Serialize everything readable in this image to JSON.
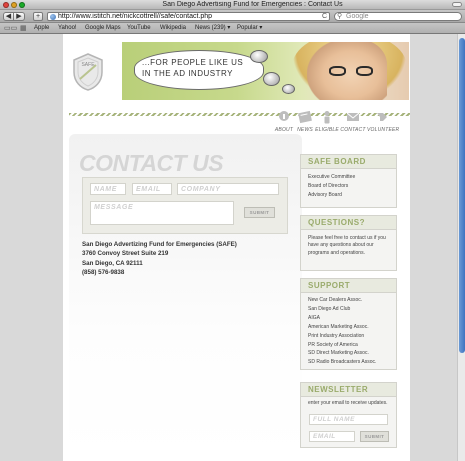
{
  "window": {
    "title": "San Diego Advertising Fund for Emergencies : Contact Us"
  },
  "toolbar": {
    "back": "◀",
    "forward": "▶",
    "add": "+",
    "url": "http://www.istitch.net/nickcottrell//safe/contact.php",
    "reload": "C",
    "search_placeholder": "Google"
  },
  "bookmarks": {
    "items": [
      "Apple",
      "Yahoo!",
      "Google Maps",
      "YouTube",
      "Wikipedia",
      "News (239) ▾",
      "Popular ▾"
    ]
  },
  "banner": {
    "line1": "...FOR PEOPLE LIKE US",
    "line2": "IN THE AD INDUSTRY"
  },
  "logo": {
    "text": "SAFE"
  },
  "top_nav": [
    "ABOUT",
    "NEWS",
    "ELIGIBLE",
    "CONTACT",
    "VOLUNTEER"
  ],
  "contact": {
    "title": "CONTACT US",
    "name_placeholder": "NAME",
    "email_placeholder": "EMAIL",
    "company_placeholder": "COMPANY",
    "message_placeholder": "MESSAGE",
    "submit": "SUBMIT",
    "address": [
      "San Diego Advertizing Fund for Emergencies (SAFE)",
      "3760 Convoy Street Suite 219",
      "San Diego, CA 92111",
      "(858) 576-9838"
    ]
  },
  "sidebar": {
    "safe_board": {
      "title": "SAFE BOARD",
      "items": [
        "Executive Committee",
        "Board of Directors",
        "Advisory Board"
      ]
    },
    "questions": {
      "title": "QUESTIONS?",
      "text": "Please feel free to contact us if you have any questions about our programs and operations."
    },
    "support": {
      "title": "SUPPORT",
      "items": [
        "New Car Dealers Assoc.",
        "San Diego Ad Club",
        "AIGA",
        "American Marketing Assoc.",
        "Print Industry Association",
        "PR Society of America",
        "SD Direct Marketing Assoc.",
        "SD Radio Broadcasters Assoc."
      ]
    },
    "newsletter": {
      "title": "NEWSLETTER",
      "hint": "enter your email to receive updates.",
      "name_placeholder": "FULL NAME",
      "email_placeholder": "EMAIL",
      "submit": "SUBMIT"
    }
  },
  "colors": {
    "accent_green": "#9aab6c",
    "title_gray": "#d5d5d5",
    "scroll_blue": "#3f73c0"
  }
}
